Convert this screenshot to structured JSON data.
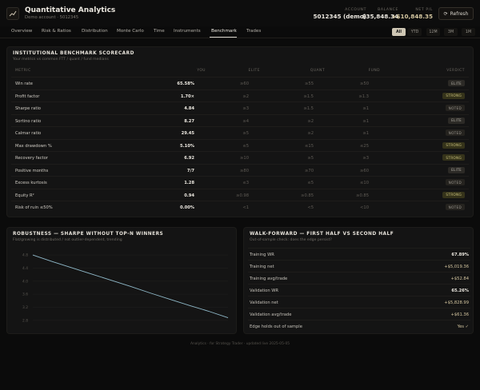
{
  "app": {
    "title": "Quantitative Analytics",
    "subtitle": "Demo account · 5012345",
    "logo_icon": "chart-icon"
  },
  "header_stats": [
    {
      "label": "ACCOUNT",
      "value": "5012345 (demo)"
    },
    {
      "label": "BALANCE",
      "value": "$35,848.34"
    },
    {
      "label": "NET P/L",
      "value": "+$10,848.35"
    }
  ],
  "refresh_label": "Refresh",
  "tabs": [
    "Overview",
    "Risk & Ratios",
    "Distribution",
    "Monte Carlo",
    "Time",
    "Instruments",
    "Benchmark",
    "Trades"
  ],
  "active_tab": "Benchmark",
  "periods": [
    "All",
    "YTD",
    "12M",
    "3M",
    "1M"
  ],
  "active_period": "All",
  "scorecard": {
    "title": "INSTITUTIONAL BENCHMARK SCORECARD",
    "subtitle": "Your metrics vs common FTT / quant / fund medians",
    "columns": [
      "METRIC",
      "YOU",
      "ELITE",
      "QUANT",
      "FUND",
      "VERDICT"
    ],
    "rows": [
      {
        "metric": "Win rate",
        "you": "65.58%",
        "elite": "≥60",
        "quant": "≥55",
        "fund": "≥50",
        "verdict": "ELITE"
      },
      {
        "metric": "Profit factor",
        "you": "1.70×",
        "elite": "≥2",
        "quant": "≥1.5",
        "fund": "≥1.3",
        "verdict": "STRONG"
      },
      {
        "metric": "Sharpe ratio",
        "you": "4.84",
        "elite": "≥3",
        "quant": "≥1.5",
        "fund": "≥1",
        "verdict": "NOTED"
      },
      {
        "metric": "Sortino ratio",
        "you": "8.27",
        "elite": "≥4",
        "quant": "≥2",
        "fund": "≥1",
        "verdict": "ELITE"
      },
      {
        "metric": "Calmar ratio",
        "you": "29.45",
        "elite": "≥5",
        "quant": "≥2",
        "fund": "≥1",
        "verdict": "NOTED"
      },
      {
        "metric": "Max drawdown %",
        "you": "5.10%",
        "elite": "≤5",
        "quant": "≤15",
        "fund": "≤25",
        "verdict": "STRONG"
      },
      {
        "metric": "Recovery factor",
        "you": "6.92",
        "elite": "≥10",
        "quant": "≥5",
        "fund": "≥3",
        "verdict": "STRONG"
      },
      {
        "metric": "Positive months",
        "you": "7/7",
        "elite": "≥80",
        "quant": "≥70",
        "fund": "≥60",
        "verdict": "ELITE"
      },
      {
        "metric": "Excess kurtosis",
        "you": "1.28",
        "elite": "≤3",
        "quant": "≤5",
        "fund": "≤10",
        "verdict": "NOTED"
      },
      {
        "metric": "Equity R²",
        "you": "0.94",
        "elite": "≥0.98",
        "quant": "≥0.85",
        "fund": "≥0.85",
        "verdict": "STRONG"
      },
      {
        "metric": "Risk of ruin ≤50%",
        "you": "0.00%",
        "elite": "<1",
        "quant": "<5",
        "fund": "<10",
        "verdict": "NOTED"
      }
    ]
  },
  "robustness": {
    "title": "ROBUSTNESS — SHARPE WITHOUT TOP-N WINNERS",
    "subtitle": "Flat/growing is distributed / not outlier-dependent, trending",
    "chart_data": {
      "type": "line",
      "title": "",
      "xlabel": "",
      "ylabel": "",
      "y_ticks": [
        "4.8",
        "4.4",
        "4.0",
        "3.6",
        "3.2",
        "2.8"
      ],
      "ylim": [
        2.6,
        4.9
      ],
      "x": [
        0,
        1,
        2,
        3,
        4,
        5,
        6,
        7,
        8,
        9,
        10
      ],
      "series": [
        {
          "values": [
            4.8,
            4.6,
            4.41,
            4.22,
            4.03,
            3.84,
            3.64,
            3.45,
            3.26,
            3.08,
            2.88
          ]
        }
      ],
      "grid": true,
      "line_color": "#8fb9c9"
    }
  },
  "walkforward": {
    "title": "WALK-FORWARD — FIRST HALF VS SECOND HALF",
    "subtitle": "Out-of-sample check: does the edge persist?",
    "rows": [
      {
        "label": "Training WR",
        "value": "67.89%"
      },
      {
        "label": "Training net",
        "value": "+$5,019.36"
      },
      {
        "label": "Training avg/trade",
        "value": "+$52.84"
      },
      {
        "label": "Validation WR",
        "value": "65.26%"
      },
      {
        "label": "Validation net",
        "value": "+$5,828.99"
      },
      {
        "label": "Validation avg/trade",
        "value": "+$61.36"
      },
      {
        "label": "Edge holds out of sample",
        "value": "Yes ✓"
      }
    ]
  },
  "footer": "Analytics · for Strategy Trader · updated live 2025-05-05"
}
